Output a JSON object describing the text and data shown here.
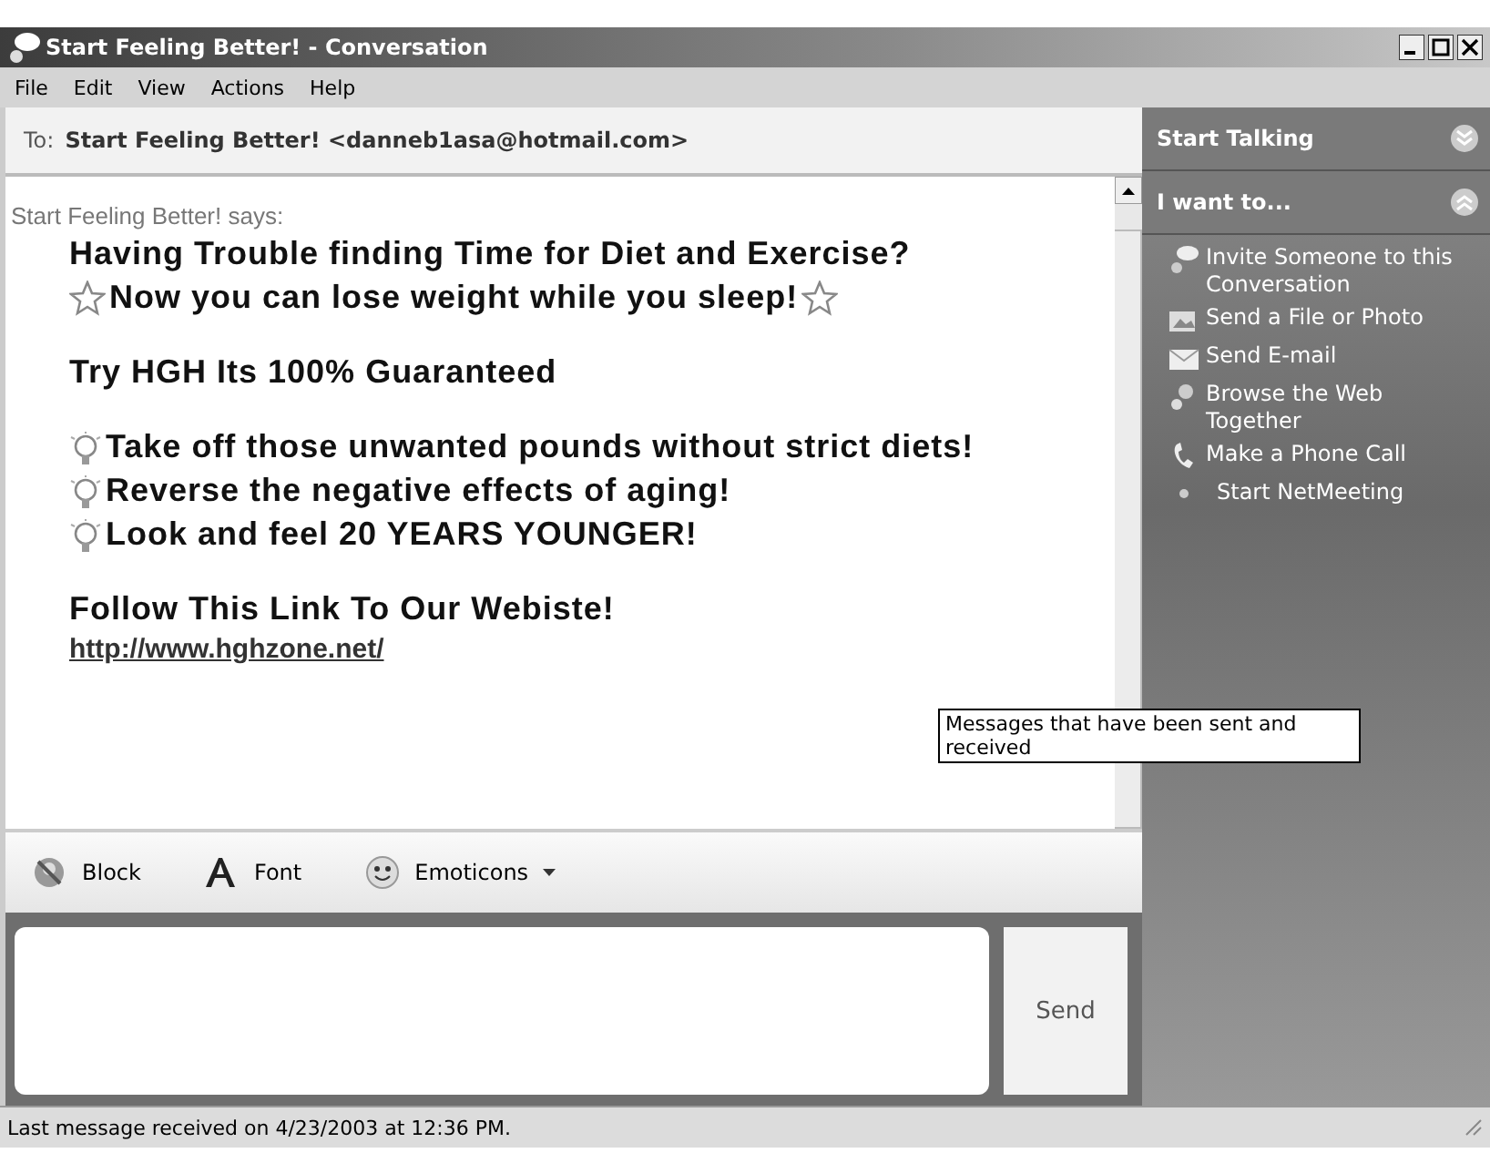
{
  "window": {
    "title": "Start Feeling Better! - Conversation"
  },
  "menu": [
    "File",
    "Edit",
    "View",
    "Actions",
    "Help"
  ],
  "to": {
    "label": "To:",
    "contact": "Start Feeling Better! <danneb1asa@hotmail.com>"
  },
  "message": {
    "sender": "Start Feeling Better! says:",
    "lines": [
      {
        "kind": "plain",
        "text": "Having Trouble finding Time for Diet and Exercise?",
        "spaced": false
      },
      {
        "kind": "starred",
        "text": "Now you can lose weight while you sleep!",
        "spaced": false
      },
      {
        "kind": "plain",
        "text": "Try HGH Its 100% Guaranteed",
        "spaced": true
      },
      {
        "kind": "bulleted",
        "text": "Take off those unwanted pounds without strict diets!",
        "spaced": true
      },
      {
        "kind": "bulleted",
        "text": "Reverse the negative effects of aging!",
        "spaced": false
      },
      {
        "kind": "bulleted",
        "text": "Look and feel 20 YEARS YOUNGER!",
        "spaced": false
      },
      {
        "kind": "plain",
        "text": "Follow This Link To Our Webiste!",
        "spaced": true
      },
      {
        "kind": "link",
        "text": "http://www.hghzone.net/",
        "spaced": false
      }
    ]
  },
  "tooltip": "Messages that have been sent and received",
  "toolbar": [
    {
      "kind": "block",
      "label": "Block"
    },
    {
      "kind": "font",
      "label": "Font"
    },
    {
      "kind": "emoticons",
      "label": "Emoticons"
    }
  ],
  "send_button": "Send",
  "sidebar": {
    "sections": [
      {
        "title": "Start Talking",
        "expanded": false
      },
      {
        "title": "I want to...",
        "expanded": true,
        "items": [
          {
            "kind": "invite",
            "label": "Invite Someone to this Conversation"
          },
          {
            "kind": "file",
            "label": "Send a File or Photo"
          },
          {
            "kind": "email",
            "label": "Send E-mail"
          },
          {
            "kind": "browse",
            "label": "Browse the Web Together"
          },
          {
            "kind": "phone",
            "label": "Make a Phone Call"
          },
          {
            "kind": "netmeeting",
            "label": "Start NetMeeting"
          }
        ]
      }
    ]
  },
  "status_bar": "Last message received on 4/23/2003 at 12:36 PM."
}
